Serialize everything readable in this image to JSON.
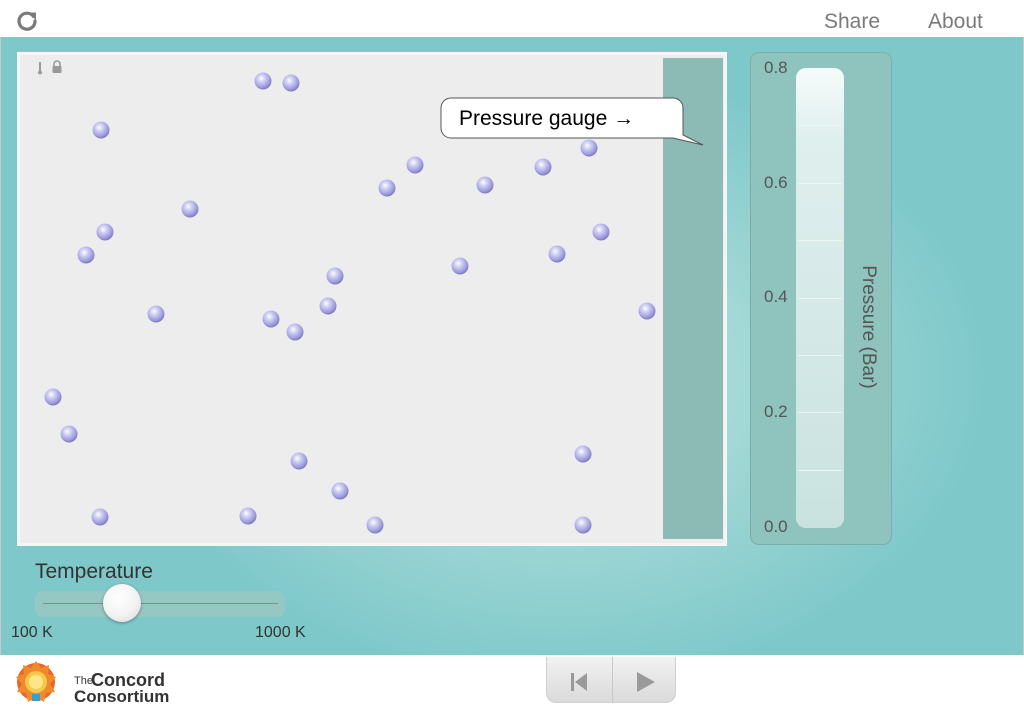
{
  "topbar": {
    "share_label": "Share",
    "about_label": "About",
    "reload_icon": "reload-icon"
  },
  "callout": {
    "text": "Pressure gauge →"
  },
  "gauge": {
    "title": "Pressure (Bar)",
    "ticks": [
      "0.8",
      "0.6",
      "0.4",
      "0.2",
      "0.0"
    ],
    "value": 0.0,
    "max": 0.8
  },
  "temperature": {
    "title": "Temperature",
    "min_label": "100 K",
    "max_label": "1000 K",
    "value_fraction": 0.35
  },
  "container": {
    "atom_count": 31
  },
  "logo": {
    "the": "The",
    "concord": "Concord",
    "consortium": "Consortium"
  },
  "colors": {
    "teal": "#7ec8ca",
    "atom": "#a7a5e3",
    "wall": "#8cbab4"
  }
}
